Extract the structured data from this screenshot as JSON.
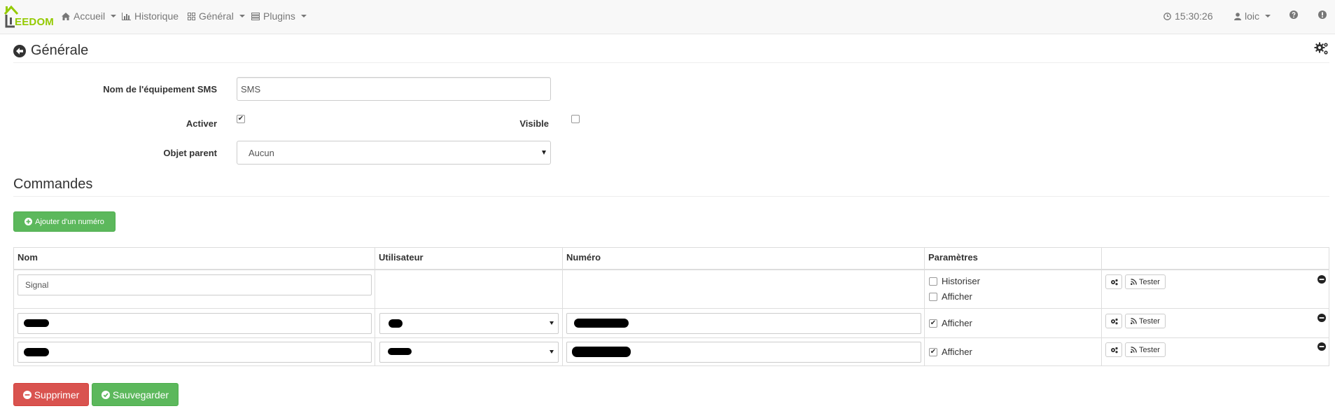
{
  "app": {
    "logo_text": "EEDOM",
    "brand_color": "#94ca02"
  },
  "nav": {
    "items": [
      {
        "label": "Accueil",
        "icon": "home-icon",
        "dropdown": true
      },
      {
        "label": "Historique",
        "icon": "bar-chart-icon",
        "dropdown": false
      },
      {
        "label": "Général",
        "icon": "dashboard-icon",
        "dropdown": true
      },
      {
        "label": "Plugins",
        "icon": "tasks-icon",
        "dropdown": true
      }
    ],
    "clock": "15:30:26",
    "user": "loic"
  },
  "page": {
    "title": "Générale",
    "back_icon": "back-arrow-icon",
    "config_icon": "gears-icon"
  },
  "form": {
    "name_label": "Nom de l'équipement SMS",
    "name_value": "SMS",
    "activate_label": "Activer",
    "activate_checked": true,
    "visible_label": "Visible",
    "visible_checked": false,
    "parent_label": "Objet parent",
    "parent_value": "Aucun"
  },
  "commands": {
    "title": "Commandes",
    "add_button": "Ajouter d'un numéro",
    "headers": [
      "Nom",
      "Utilisateur",
      "Numéro",
      "Paramètres",
      ""
    ],
    "rows": [
      {
        "name": "Signal",
        "historiser_label": "Historiser",
        "historiser_checked": false,
        "afficher_label": "Afficher",
        "afficher_checked": false,
        "test_label": "Tester"
      },
      {
        "name": "",
        "afficher_label": "Afficher",
        "afficher_checked": true,
        "test_label": "Tester"
      },
      {
        "name": "",
        "afficher_label": "Afficher",
        "afficher_checked": true,
        "test_label": "Tester"
      }
    ]
  },
  "actions": {
    "delete_label": "Supprimer",
    "save_label": "Sauvegarder"
  },
  "colors": {
    "success": "#5cb85c",
    "danger": "#d9534f",
    "navbar": "#f8f8f8"
  }
}
